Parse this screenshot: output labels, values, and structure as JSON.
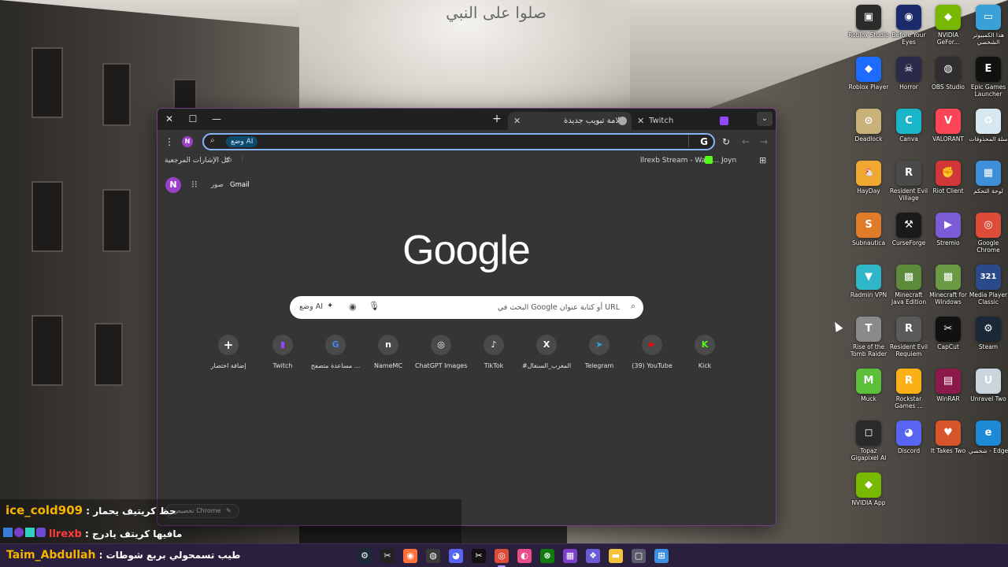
{
  "wallpaper_caption": "صلوا على النبي",
  "browser": {
    "tabs": [
      {
        "title": "علامة تبويب جديدة",
        "active": true
      },
      {
        "title": "Twitch",
        "active": false
      }
    ],
    "window_controls": {
      "close": "✕",
      "maximize": "☐",
      "minimize": "—"
    },
    "new_tab": "+",
    "omnibox": {
      "ai_mode": "وضع AI",
      "value": ""
    },
    "profile_initial": "N",
    "bookmarks": {
      "all_bookmarks": "كل الإشارات المرجعية",
      "items": [
        "llrexb Stream - Watc...",
        "Joyn"
      ]
    },
    "ntp": {
      "gmail": "Gmail",
      "images": "صور",
      "logo": "Google",
      "search_placeholder": "البحث في Google أو كتابة عنوان URL",
      "ai_mode": "وضع AI",
      "shortcuts": [
        {
          "label": "Kick",
          "icon": "kick-icon",
          "glyph": "K",
          "color": "#53fc18"
        },
        {
          "label": "(39) YouTube",
          "icon": "youtube-icon",
          "glyph": "▶",
          "color": "#ff0000"
        },
        {
          "label": "Telegram",
          "icon": "telegram-icon",
          "glyph": "➤",
          "color": "#2aa3df"
        },
        {
          "label": "#المغرب_السنغال",
          "icon": "x-icon",
          "glyph": "X",
          "color": "#ffffff"
        },
        {
          "label": "TikTok",
          "icon": "tiktok-icon",
          "glyph": "♪",
          "color": "#ffffff"
        },
        {
          "label": "ChatGPT Images",
          "icon": "chatgpt-icon",
          "glyph": "◎",
          "color": "#ffffff"
        },
        {
          "label": "NameMC",
          "icon": "namemc-icon",
          "glyph": "n",
          "color": "#ffffff"
        },
        {
          "label": "مساعدة متصفح ...",
          "icon": "google-icon",
          "glyph": "G",
          "color": "#4285f4"
        },
        {
          "label": "Twitch",
          "icon": "twitch-icon",
          "glyph": "▮",
          "color": "#9146ff"
        },
        {
          "label": "إضافة اختصار",
          "icon": "plus-icon",
          "glyph": "+",
          "color": "#ffffff"
        }
      ],
      "customize": "تخصيص Chrome"
    }
  },
  "desktop_icons": [
    {
      "label": "Roblox Studio",
      "color": "#2b2b2b",
      "glyph": "▣"
    },
    {
      "label": "Before Your Eyes",
      "color": "#1b2a6b",
      "glyph": "◉"
    },
    {
      "label": "NVIDIA GeFor...",
      "color": "#76b900",
      "glyph": "◆"
    },
    {
      "label": "هذا الكمبيوتر الشخصي",
      "color": "#3aa0d8",
      "glyph": "▭"
    },
    {
      "label": "Roblox Player",
      "color": "#1e6bff",
      "glyph": "◆"
    },
    {
      "label": "Horror",
      "color": "#2a2a4a",
      "glyph": "☠"
    },
    {
      "label": "OBS Studio",
      "color": "#302e31",
      "glyph": "◍"
    },
    {
      "label": "Epic Games Launcher",
      "color": "#111111",
      "glyph": "E"
    },
    {
      "label": "Deadlock",
      "color": "#c8b27a",
      "glyph": "⊙"
    },
    {
      "label": "Canva",
      "color": "#19b6c9",
      "glyph": "C"
    },
    {
      "label": "VALORANT",
      "color": "#fd4556",
      "glyph": "V"
    },
    {
      "label": "سلة المحذوفات",
      "color": "#d8e8f0",
      "glyph": "♻"
    },
    {
      "label": "HayDay",
      "color": "#f0a830",
      "glyph": "🐔"
    },
    {
      "label": "Resident Evil Village",
      "color": "#4a4a4a",
      "glyph": "R"
    },
    {
      "label": "Riot Client",
      "color": "#d13639",
      "glyph": "✊"
    },
    {
      "label": "لوحة التحكم",
      "color": "#3c8fd8",
      "glyph": "▦"
    },
    {
      "label": "Subnautica",
      "color": "#e07b2a",
      "glyph": "S"
    },
    {
      "label": "CurseForge",
      "color": "#1a1a1a",
      "glyph": "⚒"
    },
    {
      "label": "Stremio",
      "color": "#7b5bd6",
      "glyph": "▶"
    },
    {
      "label": "Google Chrome",
      "color": "#dd4b39",
      "glyph": "◎"
    },
    {
      "label": "Radmin VPN",
      "color": "#2fb7c9",
      "glyph": "▼"
    },
    {
      "label": "Minecraft Java Edition",
      "color": "#5a8a3a",
      "glyph": "▩"
    },
    {
      "label": "Minecraft for Windows",
      "color": "#6b9a45",
      "glyph": "▩"
    },
    {
      "label": "Media Player Classic",
      "color": "#2a4a8a",
      "glyph": "321"
    },
    {
      "label": "Rise of the Tomb Raider",
      "color": "#8a8a8a",
      "glyph": "T"
    },
    {
      "label": "Resident Evil Requiem",
      "color": "#5a5a5a",
      "glyph": "R"
    },
    {
      "label": "CapCut",
      "color": "#111111",
      "glyph": "✂"
    },
    {
      "label": "Steam",
      "color": "#1b2838",
      "glyph": "⚙"
    },
    {
      "label": "Muck",
      "color": "#5bbf3a",
      "glyph": "M"
    },
    {
      "label": "Rockstar Games ...",
      "color": "#fcaf17",
      "glyph": "R"
    },
    {
      "label": "WinRAR",
      "color": "#8b1a4a",
      "glyph": "▤"
    },
    {
      "label": "Unravel Two",
      "color": "#c9d4dc",
      "glyph": "U"
    },
    {
      "label": "Topaz Gigapixel AI",
      "color": "#2a2a2a",
      "glyph": "◻"
    },
    {
      "label": "Discord",
      "color": "#5865f2",
      "glyph": "◕"
    },
    {
      "label": "It Takes Two",
      "color": "#d8542a",
      "glyph": "♥"
    },
    {
      "label": "شخصي - Edge",
      "color": "#1c8ad4",
      "glyph": "e"
    },
    {
      "label": "NVIDIA App",
      "color": "#76b900",
      "glyph": "◆"
    }
  ],
  "chat": [
    {
      "user": "ice_cold909",
      "sep": " : ",
      "message": "حظ كريتيف يحمار"
    },
    {
      "user": "llrexb",
      "sep": " : ",
      "message": "مافيها كريتف يادرج"
    },
    {
      "user": "Taim_Abdullah",
      "sep": " : ",
      "message": "طيب تسمحولي بربع شوطات"
    }
  ],
  "taskbar": [
    {
      "name": "steam-icon",
      "glyph": "⚙",
      "color": "#1b2838"
    },
    {
      "name": "capcut-icon",
      "glyph": "✂",
      "color": "#222222"
    },
    {
      "name": "firefox-icon",
      "glyph": "◉",
      "color": "#ff7139"
    },
    {
      "name": "obs-icon",
      "glyph": "◍",
      "color": "#3a3a3a"
    },
    {
      "name": "discord-icon",
      "glyph": "◕",
      "color": "#5865f2"
    },
    {
      "name": "capcut2-icon",
      "glyph": "✂",
      "color": "#111111"
    },
    {
      "name": "chrome-icon",
      "glyph": "◎",
      "color": "#dd4b39"
    },
    {
      "name": "paint-icon",
      "glyph": "◐",
      "color": "#e94d8a"
    },
    {
      "name": "xbox-icon",
      "glyph": "⊗",
      "color": "#107c10"
    },
    {
      "name": "calendar-icon",
      "glyph": "▦",
      "color": "#7b3fc9"
    },
    {
      "name": "copilot-icon",
      "glyph": "❖",
      "color": "#6b5bd6"
    },
    {
      "name": "file-explorer-icon",
      "glyph": "▬",
      "color": "#f3c43b"
    },
    {
      "name": "window-icon",
      "glyph": "▢",
      "color": "#5a5a6a"
    },
    {
      "name": "windows-start-icon",
      "glyph": "⊞",
      "color": "#3a8fe0"
    }
  ]
}
